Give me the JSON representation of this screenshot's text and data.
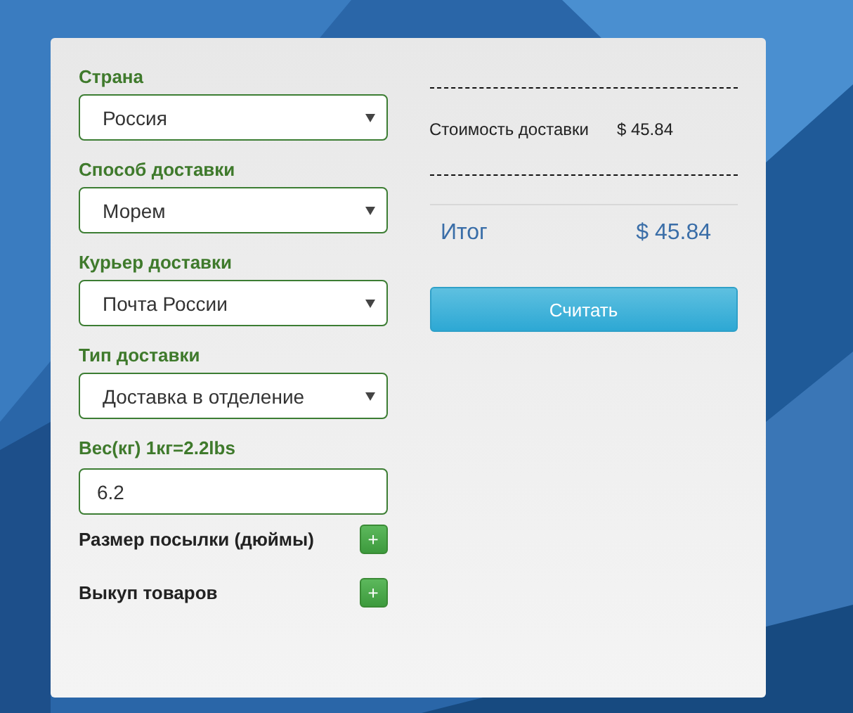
{
  "fields": [
    {
      "kind": "select",
      "label": "Страна",
      "value": "Россия"
    },
    {
      "kind": "select",
      "label": "Способ доставки",
      "value": "Морем"
    },
    {
      "kind": "select",
      "label": "Курьер доставки",
      "value": "Почта России"
    },
    {
      "kind": "select",
      "label": "Тип доставки",
      "value": "Доставка в отделение"
    },
    {
      "kind": "input",
      "label": "Вес(кг) 1кг=2.2lbs",
      "value": "6.2"
    }
  ],
  "extras": [
    {
      "label": "Размер посылки (дюймы)",
      "button": "+"
    },
    {
      "label": "Выкуп товаров",
      "button": "+"
    }
  ],
  "summary": {
    "cost_label": "Стоимость доставки",
    "cost": "$ 45.84",
    "total_label": "Итог",
    "total": "$ 45.84",
    "button": "Считать"
  }
}
